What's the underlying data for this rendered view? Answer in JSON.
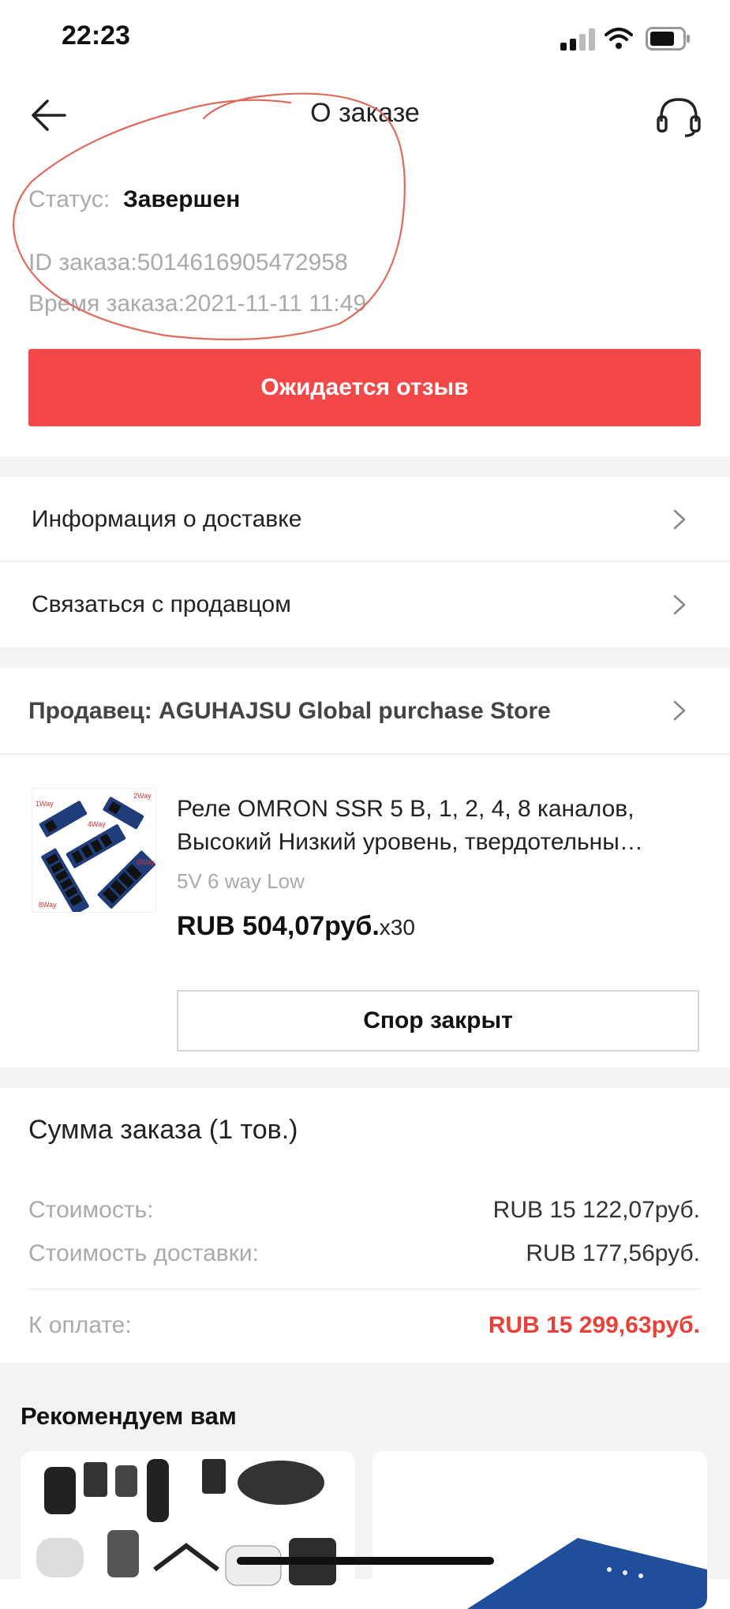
{
  "status_bar": {
    "time": "22:23"
  },
  "header": {
    "title": "О заказе"
  },
  "order": {
    "status_label": "Статус:",
    "status_value": "Завершен",
    "id_line": "ID заказа:5014616905472958",
    "time_line": "Время заказа:2021-11-11 11:49",
    "review_button": "Ожидается отзыв"
  },
  "menu": {
    "delivery": "Информация о доставке",
    "contact": "Связаться с продавцом"
  },
  "seller": {
    "label": "Продавец: AGUHAJSU Global purchase Store"
  },
  "product": {
    "title_line1": "Реле OMRON SSR 5 В, 1, 2, 4, 8 каналов,",
    "title_line2": "Высокий Низкий уровень, твердотельны…",
    "variant": "5V 6 way Low",
    "price": "RUB 504,07руб.",
    "qty": "x30",
    "image_labels": [
      "1Way",
      "2Way",
      "4Way",
      "6Way",
      "8Way"
    ],
    "dispute_button": "Спор закрыт"
  },
  "summary": {
    "title": "Сумма заказа (1 тов.)",
    "cost_label": "Стоимость:",
    "cost_value": "RUB 15 122,07руб.",
    "shipping_label": "Стоимость доставки:",
    "shipping_value": "RUB 177,56руб.",
    "total_label": "К оплате:",
    "total_value": "RUB 15 299,63руб."
  },
  "recommend": {
    "title": "Рекомендуем вам"
  },
  "colors": {
    "accent": "#f44747",
    "total": "#e9413a",
    "annotation": "#e06a5a"
  },
  "icons": [
    "back-arrow-icon",
    "headset-icon",
    "chevron-right-icon",
    "signal-icon",
    "wifi-icon",
    "battery-icon"
  ]
}
